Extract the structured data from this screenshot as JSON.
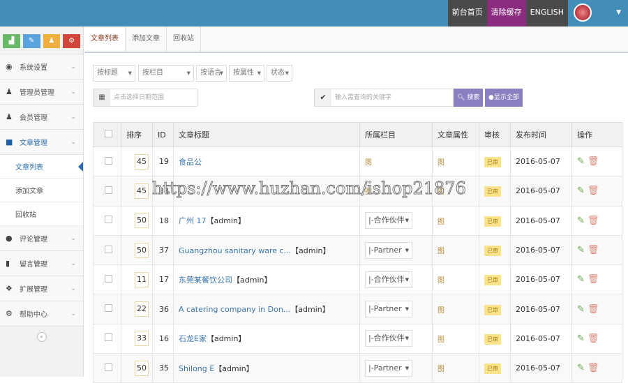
{
  "header": {
    "links": [
      "前台首页",
      "清除缓存",
      "ENGLISH"
    ]
  },
  "sidebar": {
    "items": [
      {
        "label": "系统设置",
        "icon": "dashboard-icon"
      },
      {
        "label": "管理员管理",
        "icon": "users-icon"
      },
      {
        "label": "会员管理",
        "icon": "users-icon"
      },
      {
        "label": "文章管理",
        "icon": "folder-icon"
      }
    ],
    "sub": [
      "文章列表",
      "添加文章",
      "回收站"
    ],
    "items2": [
      {
        "label": "评论管理",
        "icon": "comment-icon"
      },
      {
        "label": "留言管理",
        "icon": "book-icon"
      },
      {
        "label": "扩展管理",
        "icon": "cubes-icon"
      },
      {
        "label": "帮助中心",
        "icon": "cogs-icon"
      }
    ],
    "collapse": "«"
  },
  "tabs": [
    "文章列表",
    "添加文章",
    "回收站"
  ],
  "filters": {
    "title": "按标题",
    "column": "按栏目",
    "lang": "按语言",
    "attr": "按属性",
    "status": "状态",
    "date_placeholder": "点击选择日期范围",
    "keyword_placeholder": "输入需查询的关键字",
    "search": "搜索",
    "show_all": "显示全部"
  },
  "table": {
    "headers": [
      "排序",
      "ID",
      "文章标题",
      "所属栏目",
      "文章属性",
      "审核",
      "发布时间",
      "操作"
    ],
    "rows": [
      {
        "order": "45",
        "id": "19",
        "title": "食品公",
        "author": "",
        "cat": "",
        "attr": "图",
        "status": "已审",
        "date": "2016-05-07"
      },
      {
        "order": "45",
        "id": "38",
        "title": "",
        "author": "",
        "cat": "",
        "attr": "图",
        "status": "已审",
        "date": "2016-05-07"
      },
      {
        "order": "50",
        "id": "18",
        "title": "广州 17",
        "author": "【admin】",
        "cat": "|-合作伙伴",
        "attr": "图",
        "status": "已审",
        "date": "2016-05-07"
      },
      {
        "order": "50",
        "id": "37",
        "title": "Guangzhou sanitary ware c...",
        "author": "【admin】",
        "cat": "|-Partner",
        "attr": "图",
        "status": "已审",
        "date": "2016-05-07"
      },
      {
        "order": "11",
        "id": "17",
        "title": "东莞某餐饮公司",
        "author": "【admin】",
        "cat": "|-合作伙伴",
        "attr": "图",
        "status": "已审",
        "date": "2016-05-07"
      },
      {
        "order": "22",
        "id": "36",
        "title": "A catering company in Don...",
        "author": "【admin】",
        "cat": "|-Partner",
        "attr": "图",
        "status": "已审",
        "date": "2016-05-07"
      },
      {
        "order": "33",
        "id": "16",
        "title": "石龙E家",
        "author": "【admin】",
        "cat": "|-合作伙伴",
        "attr": "图",
        "status": "已审",
        "date": "2016-05-07"
      },
      {
        "order": "50",
        "id": "35",
        "title": "Shilong E",
        "author": "【admin】",
        "cat": "|-Partner",
        "attr": "图",
        "status": "已审",
        "date": "2016-05-07"
      }
    ]
  },
  "watermark": "https://www.huzhan.com/ishop21876"
}
